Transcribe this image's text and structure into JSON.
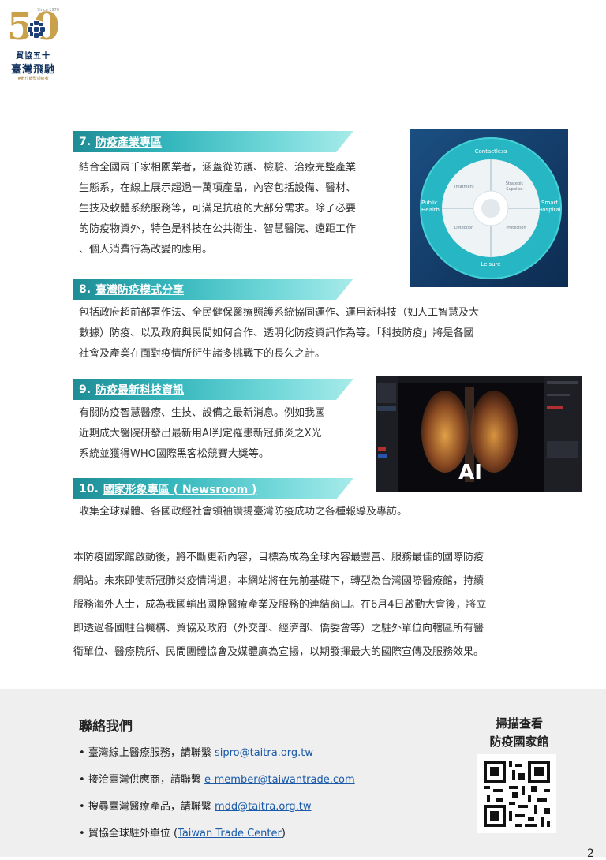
{
  "logo": {
    "since": "Since 1970",
    "number": "50",
    "line1": "貿協五十",
    "line2": "臺灣飛馳",
    "line3": "#數位轉型領航者"
  },
  "sections": [
    {
      "num": "7.",
      "title": "防疫產業專區",
      "lines": [
        "結合全國兩千家相關業者，涵蓋從防護、檢驗、治療完整產業",
        "生態系，在線上展示超過一萬項產品，內容包括設備、醫材、",
        "生技及軟體系統服務等，可滿足抗疫的大部分需求。除了必要",
        "的防疫物資外，特色是科技在公共衛生、智慧醫院、遠距工作",
        "、個人消費行為改變的應用。"
      ]
    },
    {
      "num": "8.",
      "title": "臺灣防疫模式分享",
      "lines": [
        "包括政府超前部署作法、全民健保醫療照護系統協同運作、運用新科技（如人工智慧及大",
        "數據）防疫、以及政府與民間如何合作、透明化防疫資訊作為等。「科技防疫」將是各國",
        "社會及產業在面對疫情所衍生諸多挑戰下的長久之計。"
      ]
    },
    {
      "num": "9.",
      "title": "防疫最新科技資訊",
      "lines": [
        "有關防疫智慧醫療、生技、設備之最新消息。例如我國",
        "近期成大醫院研發出最新用AI判定罹患新冠肺炎之X光",
        "系統並獲得WHO國際黑客松競賽大獎等。"
      ]
    },
    {
      "num": "10.",
      "title": "國家形象專區 ( Newsroom )",
      "lines": [
        "收集全球媒體、各國政經社會領袖讚揚臺灣防疫成功之各種報導及專訪。"
      ]
    }
  ],
  "summary": [
    "本防疫國家館啟動後，將不斷更新內容，目標為成為全球內容最豐富、服務最佳的國際防疫",
    "網站。未來即使新冠肺炎疫情消退，本網站將在先前基礎下，轉型為台灣國際醫療館，持續",
    "服務海外人士，成為我國輸出國際醫療產業及服務的連結窗口。在6月4日啟動大會後，將立",
    "即透過各國駐台機構、貿協及政府（外交部、經濟部、僑委會等）之駐外單位向轄區所有醫",
    "衛單位、醫療院所、民間團體協會及媒體廣為宣揚，以期發揮最大的國際宣傳及服務效果。"
  ],
  "wheel": {
    "outer_top": "Contactless",
    "outer_bottom": "Leisure",
    "outer_left": [
      "Public",
      "Health"
    ],
    "outer_right": [
      "Smart",
      "Hospital"
    ],
    "q1": "Treatment",
    "q2": [
      "Strategic",
      "Supplies"
    ],
    "q3": "Detection",
    "q4": "Protection"
  },
  "xray": {
    "ai": "AI"
  },
  "contact": {
    "heading": "聯絡我們",
    "items": [
      {
        "text": "臺灣線上醫療服務，請聯繫 ",
        "link": "sipro@taitra.org.tw",
        "suffix": ""
      },
      {
        "text": "接洽臺灣供應商，請聯繫 ",
        "link": "e-member@taiwantrade.com",
        "suffix": ""
      },
      {
        "text": "搜尋臺灣醫療產品，請聯繫 ",
        "link": "mdd@taitra.org.tw",
        "suffix": ""
      },
      {
        "text": "貿協全球駐外單位 (",
        "link": "Taiwan Trade Center",
        "suffix": ")"
      }
    ]
  },
  "qr": {
    "line1": "掃描查看",
    "line2": "防疫國家館"
  },
  "page": "2",
  "colors": {
    "banner_start": "#1e8c95",
    "banner_end": "#a7ebea",
    "link": "#1a5aa8",
    "footer_bg": "#efefef"
  }
}
